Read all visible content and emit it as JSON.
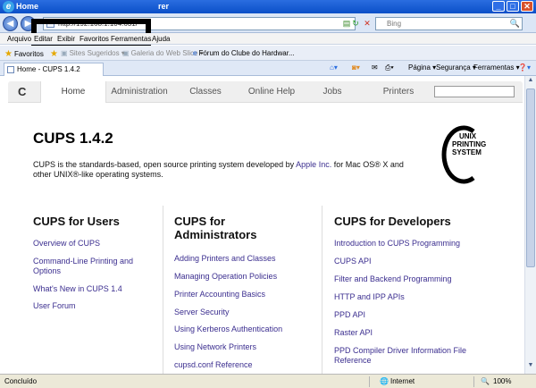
{
  "window": {
    "title": "Home",
    "title_tail": "rer",
    "buttons": [
      "_",
      "□",
      "✕"
    ]
  },
  "address": {
    "url": "http://192.168.1.104:631/",
    "search_placeholder": "Bing"
  },
  "menu": [
    "Arquivo",
    "Editar",
    "Exibir",
    "Favoritos",
    "Ferramentas",
    "Ajuda"
  ],
  "favorites": {
    "label": "Favoritos",
    "items": [
      "Sites Sugeridos ▾",
      "Galeria do Web Slice ▾",
      "Fórum do Clube do Hardwar..."
    ]
  },
  "tab": {
    "title": "Home - CUPS 1.4.2"
  },
  "command_bar": {
    "page": "Página ▾",
    "security": "Segurança ▾",
    "tools": "Ferramentas ▾",
    "help": "❓▾"
  },
  "cups_nav": {
    "logo": "C",
    "tabs": [
      "Home",
      "Administration",
      "Classes",
      "Online Help",
      "Jobs",
      "Printers"
    ]
  },
  "page": {
    "title": "CUPS 1.4.2",
    "intro_before": "CUPS is the standards-based, open source printing system developed by ",
    "intro_link": "Apple Inc.",
    "intro_after": " for Mac OS® X and other UNIX®-like operating systems.",
    "logo_lines": [
      "UNIX",
      "PRINTING",
      "SYSTEM"
    ]
  },
  "columns": {
    "users": {
      "heading": "CUPS for Users",
      "links": [
        "Overview of CUPS",
        "Command-Line Printing and Options",
        "What's New in CUPS 1.4",
        "User Forum"
      ]
    },
    "admins": {
      "heading": "CUPS for Administrators",
      "links": [
        "Adding Printers and Classes",
        "Managing Operation Policies",
        "Printer Accounting Basics",
        "Server Security",
        "Using Kerberos Authentication",
        "Using Network Printers",
        "cupsd.conf Reference"
      ]
    },
    "devs": {
      "heading": "CUPS for Developers",
      "links": [
        "Introduction to CUPS Programming",
        "CUPS API",
        "Filter and Backend Programming",
        "HTTP and IPP APIs",
        "PPD API",
        "Raster API",
        "PPD Compiler Driver Information File Reference"
      ]
    }
  },
  "status": {
    "text": "Concluído",
    "zone": "Internet",
    "zoom": "100%"
  }
}
